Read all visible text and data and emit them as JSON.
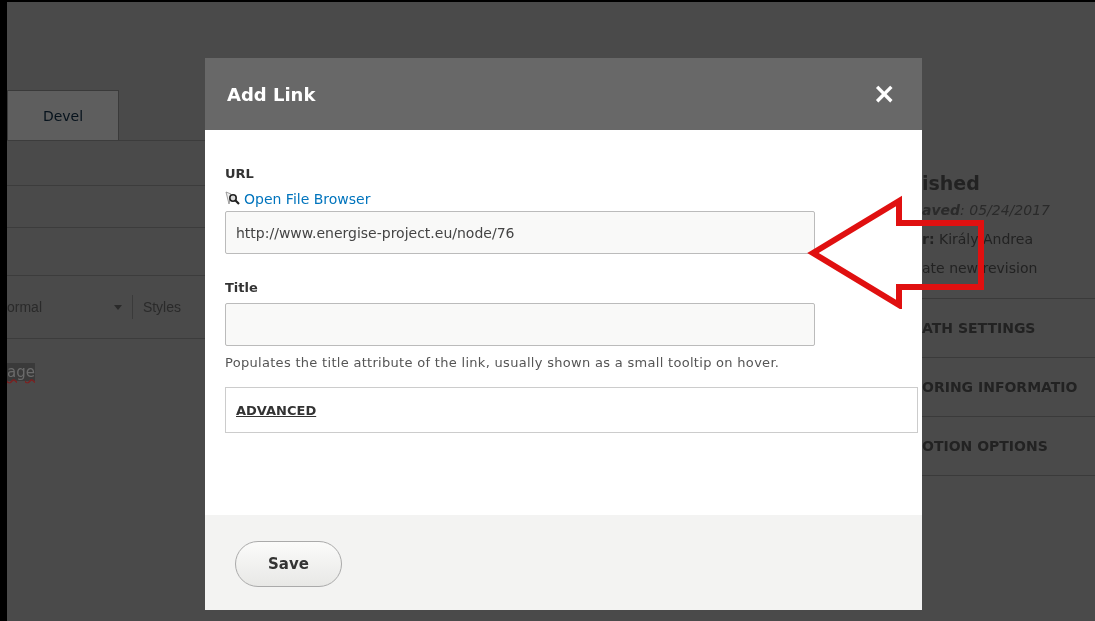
{
  "background": {
    "tabs": [
      {
        "label": "Devel"
      }
    ],
    "toolbar": {
      "format": "ormal",
      "styles": "Styles"
    },
    "editor_text": "age",
    "sidebar": {
      "status": "ished",
      "saved": "**aved**: 05/24/2017",
      "author": "**r:** Király Andrea",
      "revision": "ate new revision",
      "sections": [
        "ATH SETTINGS",
        "ORING INFORMATIO",
        "OTION OPTIONS"
      ]
    }
  },
  "dialog": {
    "title": "Add Link",
    "close": "×",
    "url_label": "URL",
    "file_browser": "Open File Browser",
    "url_value": "http://www.energise-project.eu/node/76",
    "title_label": "Title",
    "description": "Populates the title attribute of the link, usually shown as a small tooltip on hover.",
    "advanced": "ADVANCED",
    "save": "Save"
  }
}
